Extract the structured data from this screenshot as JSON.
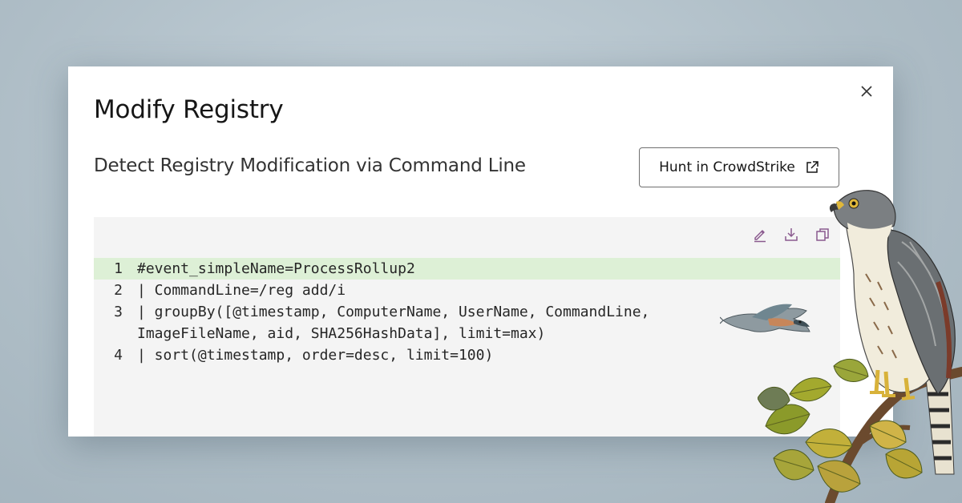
{
  "modal": {
    "title": "Modify Registry",
    "subtitle": "Detect Registry Modification via Command Line",
    "close_icon": "close-icon",
    "hunt_button": {
      "label": "Hunt in CrowdStrike",
      "icon": "external-link-icon"
    }
  },
  "code": {
    "toolbar": [
      "edit-icon",
      "download-icon",
      "copy-icon"
    ],
    "highlighted_line": 1,
    "lines": [
      {
        "number": "1",
        "text": "#event_simpleName=ProcessRollup2"
      },
      {
        "number": "2",
        "text": "| CommandLine=/reg add/i"
      },
      {
        "number": "3",
        "text": "| groupBy([@timestamp, ComputerName, UserName, CommandLine, ImageFileName, aid, SHA256HashData], limit=max)"
      },
      {
        "number": "4",
        "text": "| sort(@timestamp, order=desc, limit=100)"
      }
    ]
  },
  "colors": {
    "background": "#aebdc6",
    "highlight": "#ddf0d6",
    "code_panel": "#f4f4f4",
    "icon_purple": "#8a5a8e"
  }
}
